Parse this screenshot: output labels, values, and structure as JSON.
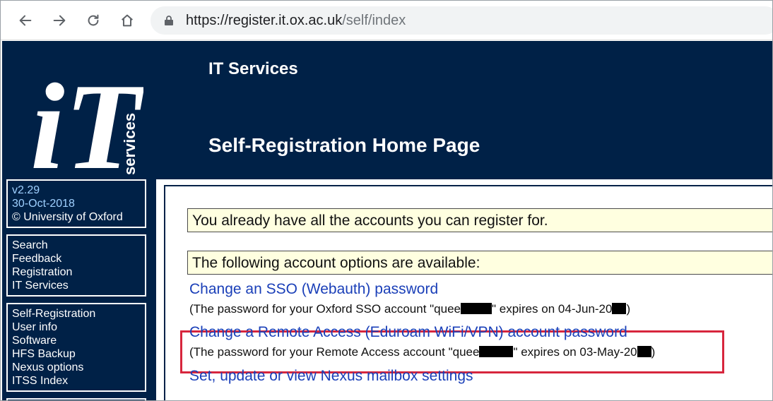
{
  "browser": {
    "url_host": "https://register.it.ox.ac.uk",
    "url_path": "/self/index"
  },
  "header": {
    "logo_text": "iT",
    "logo_subtext": "services",
    "title": "IT Services",
    "subtitle": "Self-Registration Home Page"
  },
  "sidebar": {
    "version": "v2.29",
    "date": "30-Oct-2018",
    "copyright": "© University of Oxford",
    "group1": [
      "Search",
      "Feedback",
      "Registration",
      "IT Services"
    ],
    "group2": [
      "Self-Registration",
      "User info",
      "Software",
      "HFS Backup",
      "Nexus options",
      "ITSS Index"
    ]
  },
  "content": {
    "notice_accounts": "You already have all the accounts you can register for.",
    "notice_options": "The following account options are available:",
    "options": [
      {
        "link": "Change an SSO (Webauth) password",
        "note_pre": "(The password for your Oxford SSO account \"quee",
        "note_mid": "\" expires on 04-Jun-20",
        "note_post": ")"
      },
      {
        "link": "Change a Remote Access (Eduroam WiFi/VPN) account password",
        "note_pre": "(The password for your Remote Access account \"quee",
        "note_mid": "\" expires on 03-May-20",
        "note_post": ")"
      },
      {
        "link": "Set, update or view Nexus mailbox settings"
      }
    ]
  },
  "colors": {
    "brand_navy": "#002147",
    "link_blue": "#1a3fb8",
    "notice_bg": "#ffffe0",
    "highlight_red": "#d7263d"
  }
}
